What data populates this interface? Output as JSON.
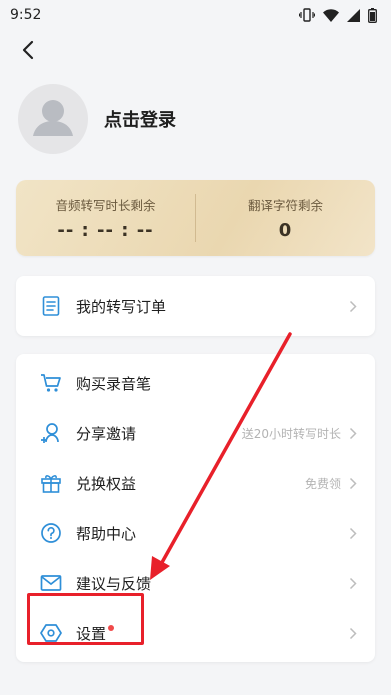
{
  "status_bar": {
    "time": "9:52"
  },
  "profile": {
    "login_label": "点击登录"
  },
  "quota": {
    "transcription_label": "音频转写时长剩余",
    "transcription_value": "-- : -- : --",
    "translation_label": "翻译字符剩余",
    "translation_value": "0"
  },
  "orders": {
    "label": "我的转写订单"
  },
  "menu": {
    "items": [
      {
        "label": "购买录音笔",
        "hint": "",
        "icon": "cart-icon"
      },
      {
        "label": "分享邀请",
        "hint": "送20小时转写时长",
        "icon": "share-person-icon"
      },
      {
        "label": "兑换权益",
        "hint": "免费领",
        "icon": "gift-icon"
      },
      {
        "label": "帮助中心",
        "hint": "",
        "icon": "help-icon"
      },
      {
        "label": "建议与反馈",
        "hint": "",
        "icon": "mail-icon"
      },
      {
        "label": "设置",
        "hint": "",
        "icon": "settings-hexagon-icon",
        "has_dot": true
      }
    ]
  },
  "colors": {
    "accent_icon": "#2f8fd8",
    "annotation_red": "#e8202a",
    "quota_gold": "#ead7b0"
  }
}
